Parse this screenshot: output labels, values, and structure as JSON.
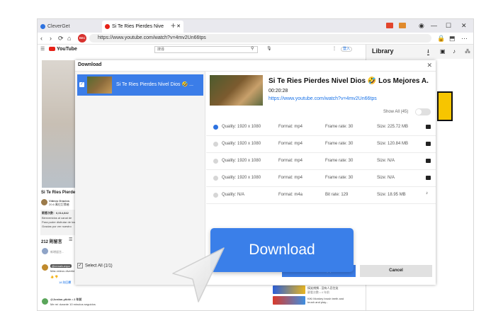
{
  "browser": {
    "tabs": [
      {
        "label": "CleverGet"
      },
      {
        "label": "Si Te Ries Pierdes Nive"
      }
    ],
    "new_tab": "+",
    "record_badge": "REC",
    "url": "https://www.youtube.com/watch?v=4mv2Un66tps",
    "window_controls": [
      "—",
      "☐",
      "✕"
    ]
  },
  "youtube": {
    "logo": "YouTube",
    "search_placeholder": "搜尋",
    "login": "登入",
    "video_title": "Si Te Ries Pierdes",
    "channel": "Videos Gracios",
    "channel_sub": "20.6 萬位訂閱者",
    "stats": "觀看次數：6,014,842",
    "desc_lines": [
      "Bienvenidos al canal de",
      "Para poder disfrutar de los",
      "Gracias por ver nuestro"
    ],
    "comments_count": "212 則留言",
    "comment_placeholder": "新增留言...",
    "comment_user": "@remahuerpa",
    "comment_text": "Más videos divertid",
    "replies": "18 則回覆",
    "commenter2": "@Jordan-ytbhh • 2 年前",
    "comment2_text": "Me reí durante 10 minutos seguidos",
    "side_videos": [
      {
        "title": "搞笑視頻 - 沒有人忍住笑",
        "meta": "觀看次數 • 4 年前"
      },
      {
        "title": "KiKi Monkey brush teeth and brush and play..."
      }
    ]
  },
  "library": {
    "title": "Library"
  },
  "dialog": {
    "title": "Download",
    "close": "✕",
    "item_title": "Si Te Ries Pierdes Nivel Dios 🤣 ...",
    "select_all": "Select All (1/1)",
    "video": {
      "title": "Si Te Ries Pierdes Nivel Dios 🤣 Los Mejores A.",
      "duration": "00:20:28",
      "url": "https://www.youtube.com/watch?v=4mv2Un66tps"
    },
    "show_all": "Show All (45)",
    "formats": [
      {
        "quality": "Quality: 1920 x 1080",
        "format": "Format: mp4",
        "rate": "Frame rate: 30",
        "size": "Size: 225.72 MB",
        "selected": true,
        "kind": "video"
      },
      {
        "quality": "Quality: 1920 x 1080",
        "format": "Format: mp4",
        "rate": "Frame rate: 30",
        "size": "Size: 120.84 MB",
        "selected": false,
        "kind": "video"
      },
      {
        "quality": "Quality: 1920 x 1080",
        "format": "Format: mp4",
        "rate": "Frame rate: 30",
        "size": "Size: N/A",
        "selected": false,
        "kind": "video"
      },
      {
        "quality": "Quality: 1920 x 1080",
        "format": "Format: mp4",
        "rate": "Frame rate: 30",
        "size": "Size: N/A",
        "selected": false,
        "kind": "video"
      },
      {
        "quality": "Quality: N/A",
        "format": "Format: m4a",
        "rate": "Bit rate: 129",
        "size": "Size: 18.95 MB",
        "selected": false,
        "kind": "audio"
      }
    ],
    "download_label": "Download (1)",
    "cancel_label": "Cancel"
  },
  "overlay": {
    "big_download": "Download"
  },
  "colors": {
    "accent": "#3b7de8",
    "youtube_red": "#e62117",
    "record_red": "#d8312e"
  }
}
